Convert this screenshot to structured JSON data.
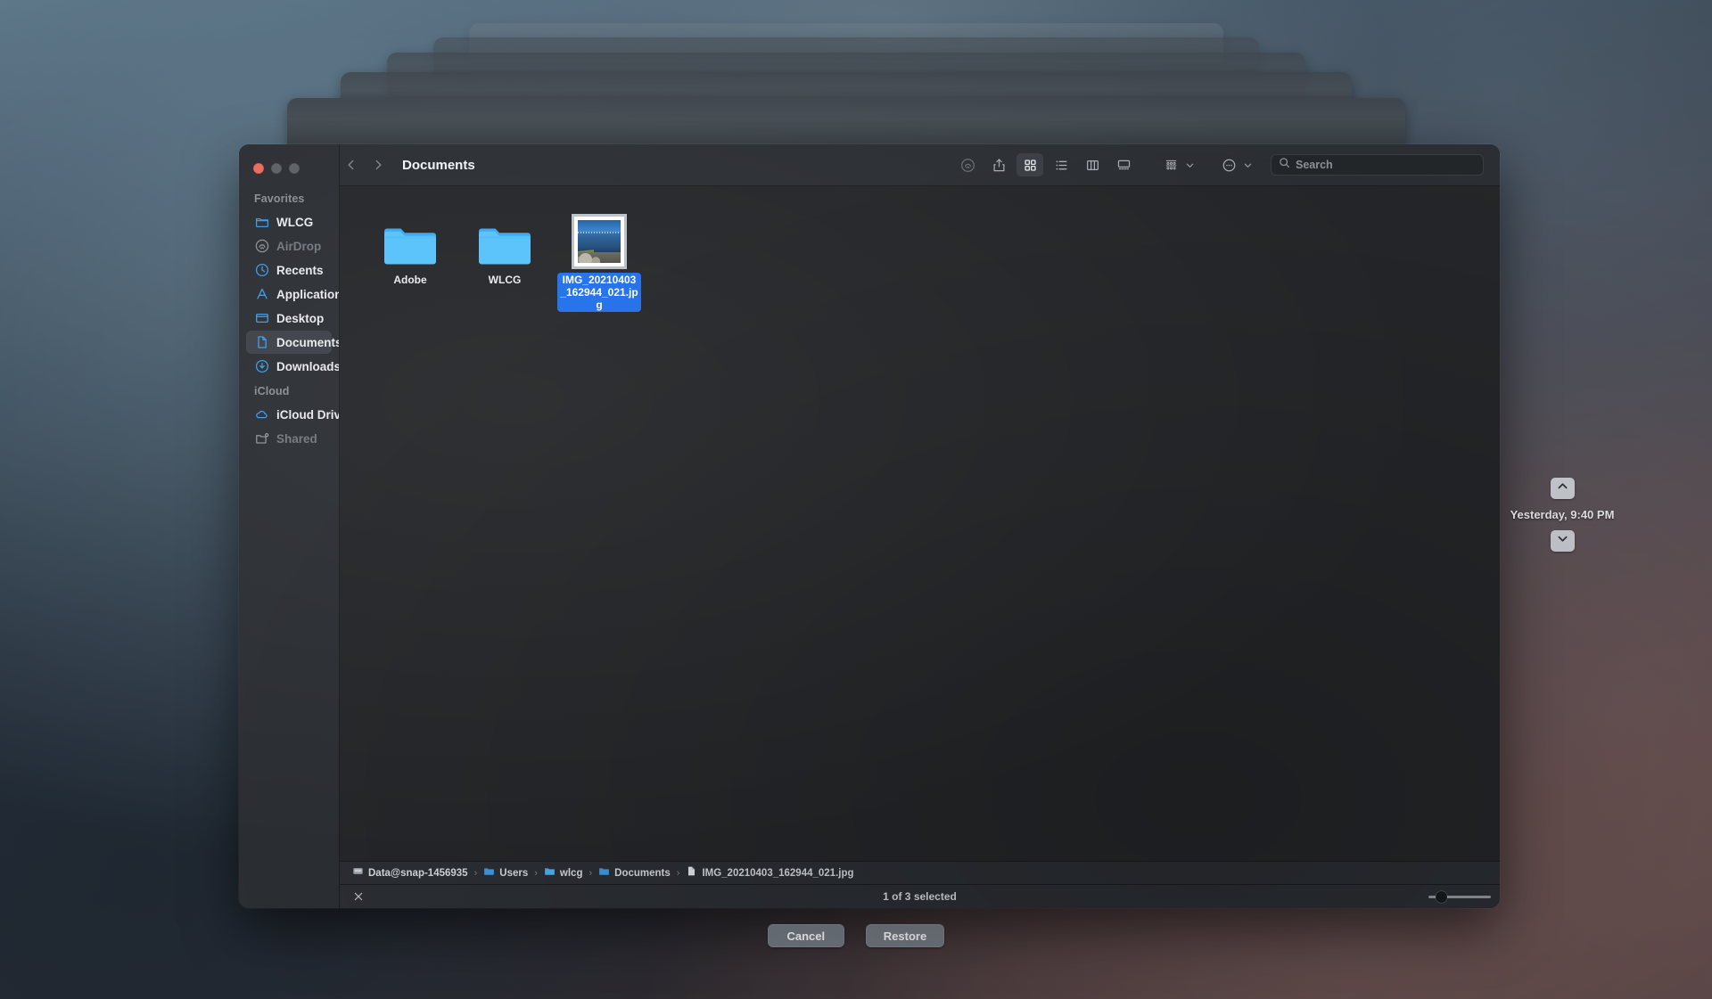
{
  "window": {
    "title": "Documents",
    "traffic_lights": [
      "close",
      "minimize",
      "maximize"
    ]
  },
  "sidebar": {
    "sections": [
      {
        "label": "Favorites",
        "items": [
          {
            "label": "WLCG",
            "icon": "folder-icon",
            "state": "normal"
          },
          {
            "label": "AirDrop",
            "icon": "airdrop-icon",
            "state": "dim"
          },
          {
            "label": "Recents",
            "icon": "clock-icon",
            "state": "normal"
          },
          {
            "label": "Applications",
            "icon": "applications-icon",
            "state": "normal"
          },
          {
            "label": "Desktop",
            "icon": "desktop-icon",
            "state": "normal"
          },
          {
            "label": "Documents",
            "icon": "document-icon",
            "state": "selected"
          },
          {
            "label": "Downloads",
            "icon": "downloads-icon",
            "state": "normal"
          }
        ]
      },
      {
        "label": "iCloud",
        "items": [
          {
            "label": "iCloud Drive",
            "icon": "cloud-icon",
            "state": "normal"
          },
          {
            "label": "Shared",
            "icon": "shared-folder-icon",
            "state": "dim"
          }
        ]
      }
    ]
  },
  "toolbar": {
    "back_icon": "chevron-left-icon",
    "forward_icon": "chevron-right-icon",
    "title": "Documents",
    "buttons": [
      {
        "name": "airdrop-icon",
        "state": "dim"
      },
      {
        "name": "share-icon",
        "state": "normal"
      },
      {
        "name": "icon-view-icon",
        "state": "active"
      },
      {
        "name": "list-view-icon",
        "state": "normal"
      },
      {
        "name": "column-view-icon",
        "state": "normal"
      },
      {
        "name": "gallery-view-icon",
        "state": "normal"
      },
      {
        "name": "group-by-icon",
        "state": "normal"
      },
      {
        "name": "actions-icon",
        "state": "normal"
      }
    ]
  },
  "search": {
    "placeholder": "Search",
    "value": "",
    "icon": "search-icon"
  },
  "files": [
    {
      "name": "Adobe",
      "type": "folder",
      "selected": false
    },
    {
      "name": "WLCG",
      "type": "folder",
      "selected": false
    },
    {
      "name": "IMG_20210403_162944_021.jpg",
      "type": "image",
      "selected": true
    }
  ],
  "path_bar": {
    "crumbs": [
      {
        "label": "Data@snap-1456935",
        "icon": "drive-icon"
      },
      {
        "label": "Users",
        "icon": "folder-icon"
      },
      {
        "label": "wlcg",
        "icon": "home-folder-icon"
      },
      {
        "label": "Documents",
        "icon": "folder-icon"
      },
      {
        "label": "IMG_20210403_162944_021.jpg",
        "icon": "file-icon"
      }
    ],
    "separator": "›"
  },
  "status_bar": {
    "close_icon": "close-icon",
    "selection_text": "1 of 3 selected",
    "zoom_slider_value": 11
  },
  "time_machine": {
    "up_icon": "chevron-up-icon",
    "down_icon": "chevron-down-icon",
    "date_label": "Yesterday, 9:40 PM"
  },
  "actions": {
    "cancel_label": "Cancel",
    "restore_label": "Restore"
  },
  "colors": {
    "accent_selection": "#1f6feb",
    "folder_blue": "#4ab8f5",
    "sidebar_bg": "#2b2e33",
    "content_bg": "#242629",
    "close_button": "#ec6a5e"
  }
}
